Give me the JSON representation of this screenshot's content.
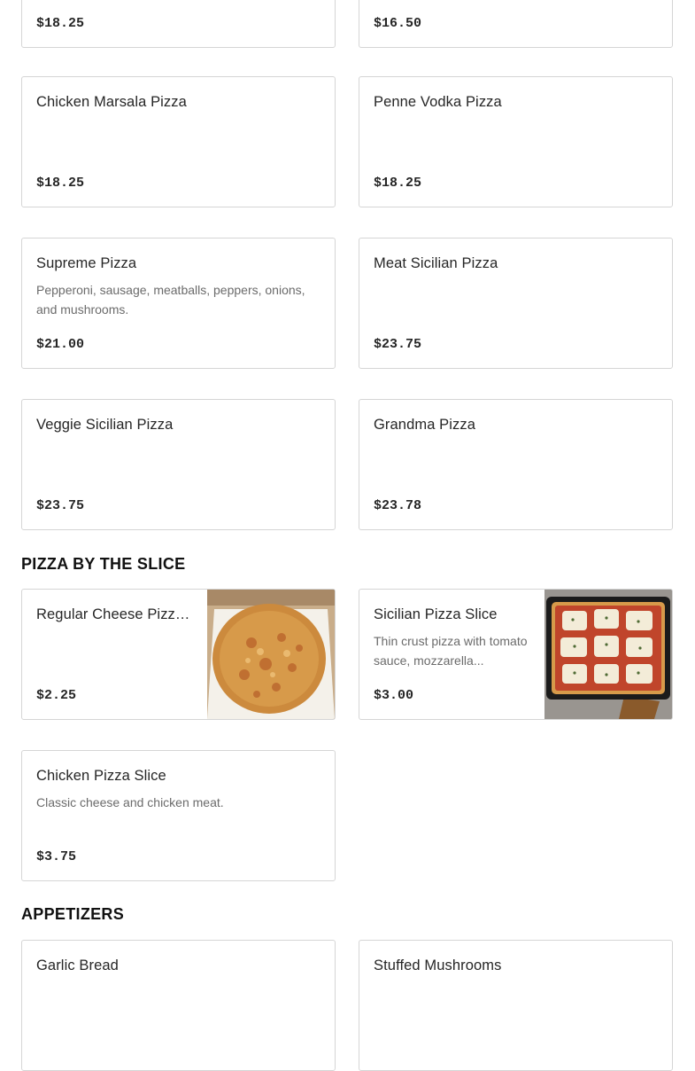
{
  "sections": {
    "pizza_by_the_slice": "PIZZA BY THE SLICE",
    "appetizers": "APPETIZERS"
  },
  "items": {
    "top_left": {
      "price": "$18.25"
    },
    "top_right": {
      "price": "$16.50"
    },
    "chicken_marsala": {
      "name": "Chicken Marsala Pizza",
      "price": "$18.25"
    },
    "penne_vodka": {
      "name": "Penne Vodka Pizza",
      "price": "$18.25"
    },
    "supreme": {
      "name": "Supreme Pizza",
      "description": "Pepperoni, sausage, meatballs, peppers, onions, and mushrooms.",
      "price": "$21.00"
    },
    "meat_sicilian": {
      "name": "Meat Sicilian Pizza",
      "price": "$23.75"
    },
    "veggie_sicilian": {
      "name": "Veggie Sicilian Pizza",
      "price": "$23.75"
    },
    "grandma": {
      "name": "Grandma Pizza",
      "price": "$23.78"
    },
    "regular_cheese_slice": {
      "name": "Regular Cheese Pizza...",
      "price": "$2.25"
    },
    "sicilian_slice": {
      "name": "Sicilian Pizza Slice",
      "description": "Thin crust pizza with tomato sauce, mozzarella...",
      "price": "$3.00"
    },
    "chicken_slice": {
      "name": "Chicken Pizza Slice",
      "description": "Classic cheese and chicken meat.",
      "price": "$3.75"
    },
    "garlic_bread": {
      "name": "Garlic Bread"
    },
    "stuffed_mushrooms": {
      "name": "Stuffed Mushrooms"
    }
  }
}
